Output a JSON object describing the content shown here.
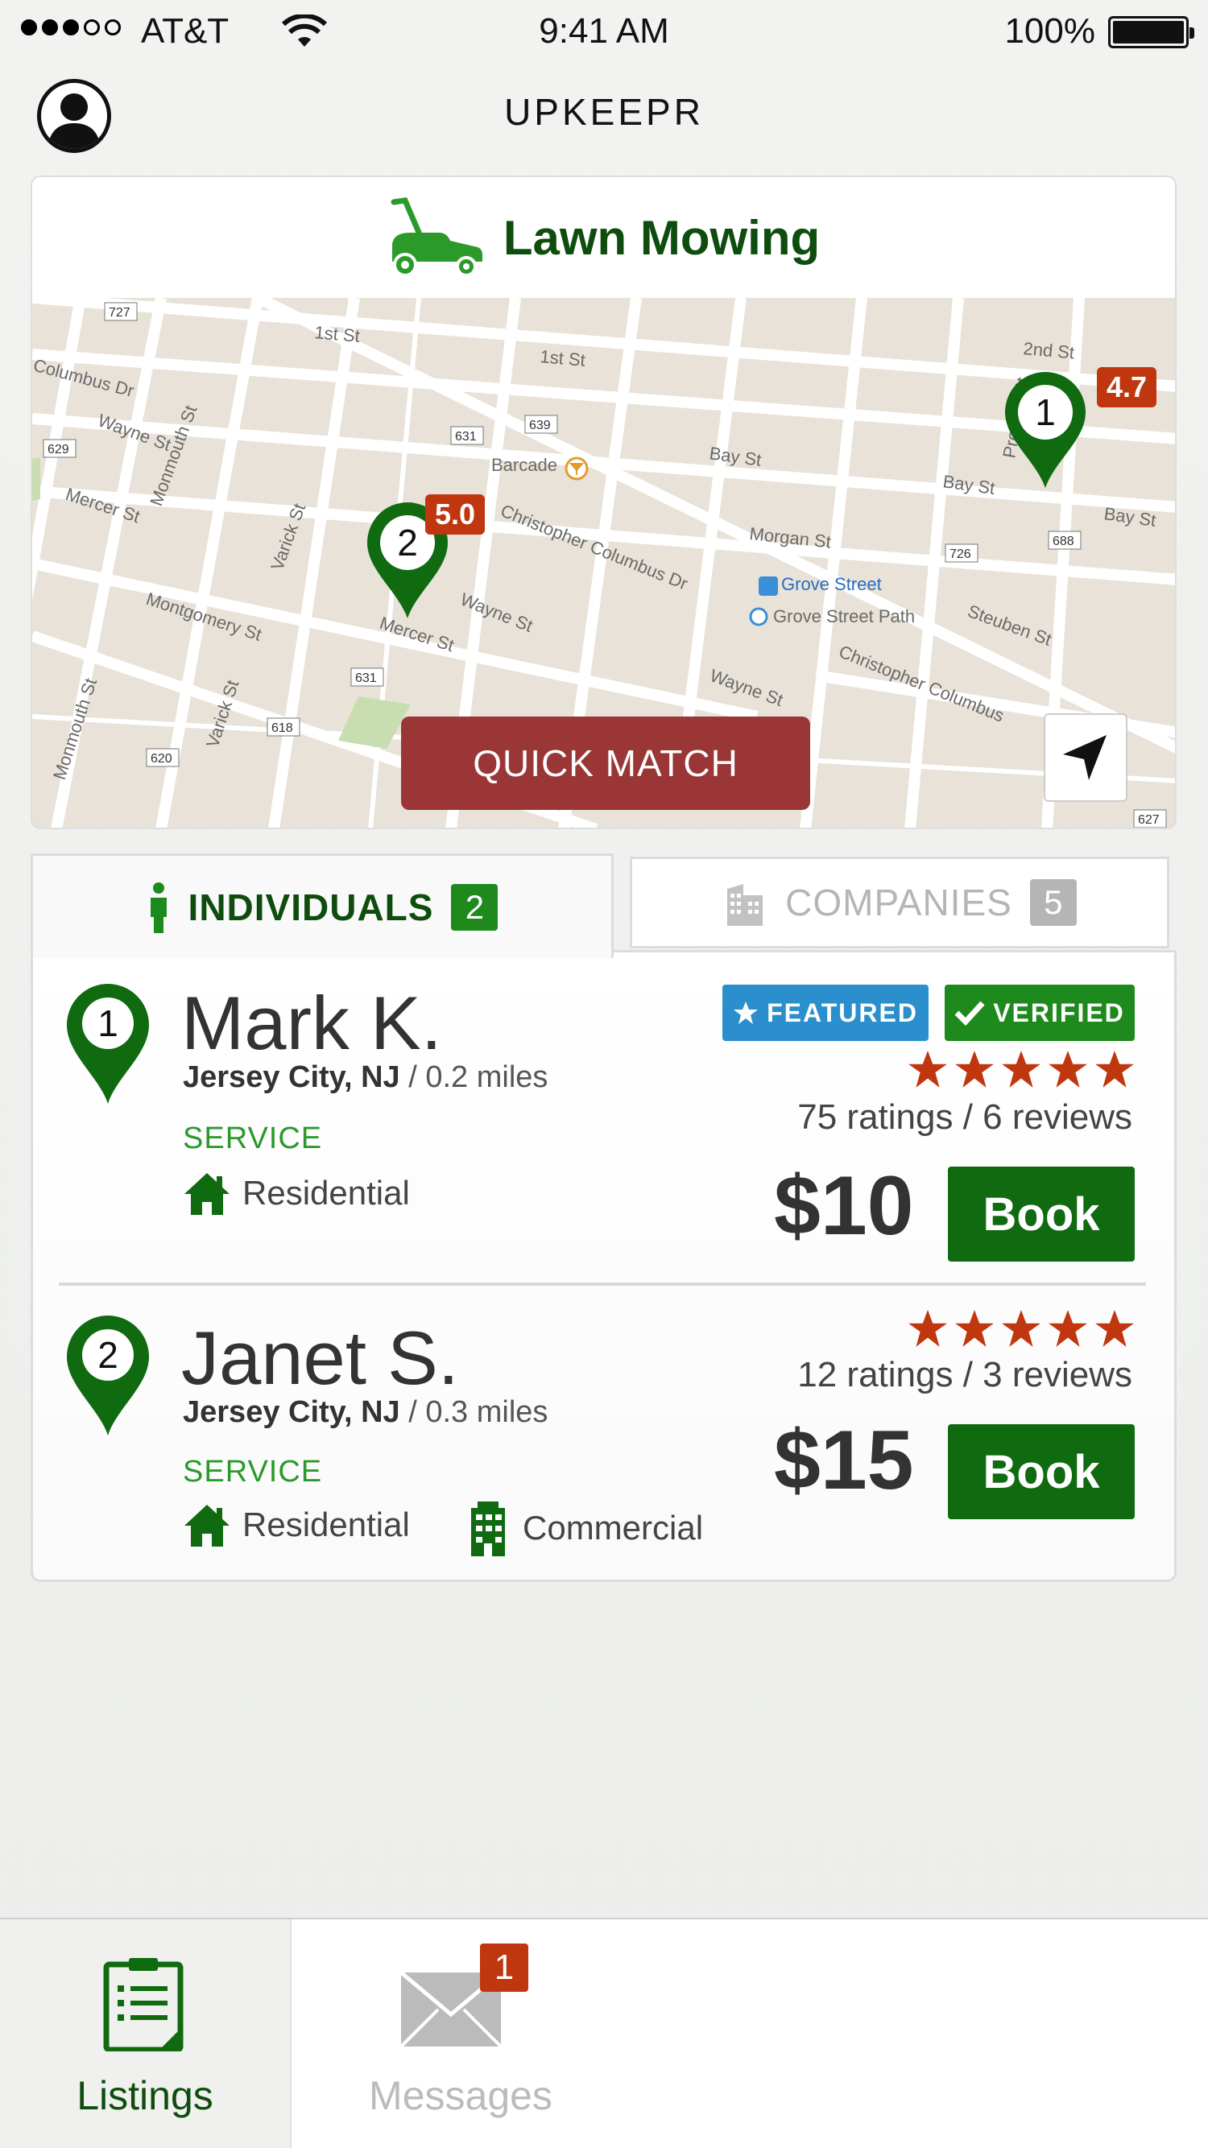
{
  "status_bar": {
    "carrier": "AT&T",
    "time": "9:41 AM",
    "battery": "100%"
  },
  "header": {
    "title": "UPKEEPR"
  },
  "service": {
    "title": "Lawn Mowing",
    "icon": "lawn-mower-icon"
  },
  "map": {
    "streets": [
      "1st St",
      "2nd St",
      "Columbus Dr",
      "Wayne St",
      "Mercer St",
      "Montgomery St",
      "Monmouth St",
      "Varick St",
      "Christopher Columbus Dr",
      "Bay St",
      "Morgan St",
      "Steuben St",
      "Provost St",
      "Christopher Columbus"
    ],
    "route_shields": [
      "727",
      "629",
      "631",
      "639",
      "726",
      "688",
      "631",
      "618",
      "620",
      "627"
    ],
    "places": {
      "barcade": "Barcade",
      "grove_street": "Grove Street",
      "grove_street_path": "Grove Street Path"
    },
    "pins": [
      {
        "number": "1",
        "rating": "4.7"
      },
      {
        "number": "2",
        "rating": "5.0"
      }
    ],
    "quick_match": "QUICK MATCH"
  },
  "tabs": {
    "individuals": {
      "label": "INDIVIDUALS",
      "count": "2"
    },
    "companies": {
      "label": "COMPANIES",
      "count": "5"
    }
  },
  "listings": [
    {
      "number": "1",
      "name": "Mark K.",
      "city": "Jersey City, NJ",
      "distance": "/ 0.2 miles",
      "service_label": "SERVICE",
      "types": [
        "Residential"
      ],
      "badges": {
        "featured": "FEATURED",
        "verified": "VERIFIED"
      },
      "stars": 5,
      "stats": "75 ratings / 6 reviews",
      "price": "$10",
      "book": "Book"
    },
    {
      "number": "2",
      "name": "Janet S.",
      "city": "Jersey City, NJ",
      "distance": "/ 0.3 miles",
      "service_label": "SERVICE",
      "types": [
        "Residential",
        "Commercial"
      ],
      "stars": 5,
      "stats": "12 ratings / 3 reviews",
      "price": "$15",
      "book": "Book"
    }
  ],
  "tab_bar": {
    "listings": "Listings",
    "messages": "Messages",
    "messages_badge": "1"
  },
  "colors": {
    "brand_green": "#0f6a10",
    "accent_red": "#9a3636",
    "rating_red": "#c0370f",
    "featured_blue": "#2a8fcc"
  }
}
